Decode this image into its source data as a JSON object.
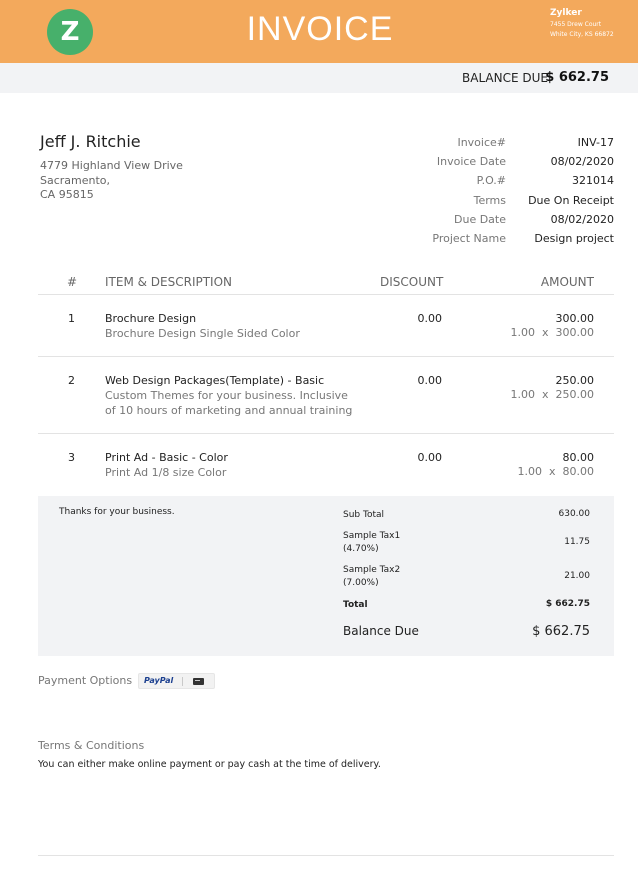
{
  "header": {
    "logo_letter": "Z",
    "title": "INVOICE",
    "company_name": "Zylker",
    "company_address": [
      "7455 Drew Court",
      "White City, KS 66872"
    ],
    "accent_color": "#f3a95c",
    "logo_color": "#47b06b"
  },
  "balance_bar": {
    "label": "BALANCE DUE",
    "value": "$ 662.75"
  },
  "customer": {
    "name": "Jeff J. Ritchie",
    "address": [
      "4779 Highland View Drive",
      "Sacramento,",
      "CA 95815"
    ]
  },
  "meta": [
    {
      "label": "Invoice#",
      "value": "INV-17"
    },
    {
      "label": "Invoice Date",
      "value": "08/02/2020"
    },
    {
      "label": "P.O.#",
      "value": "321014"
    },
    {
      "label": "Terms",
      "value": "Due On Receipt"
    },
    {
      "label": "Due Date",
      "value": "08/02/2020"
    },
    {
      "label": "Project Name",
      "value": "Design project"
    }
  ],
  "table": {
    "headers": {
      "num": "#",
      "item": "ITEM & DESCRIPTION",
      "discount": "DISCOUNT",
      "amount": "AMOUNT"
    },
    "rows": [
      {
        "num": "1",
        "title": "Brochure Design",
        "description": "Brochure Design Single Sided Color",
        "discount": "0.00",
        "amount": "300.00",
        "qty_line": "1.00  x  300.00"
      },
      {
        "num": "2",
        "title": "Web Design Packages(Template) - Basic",
        "description": "Custom Themes for your business. Inclusive of 10 hours of marketing and annual training",
        "discount": "0.00",
        "amount": "250.00",
        "qty_line": "1.00  x  250.00"
      },
      {
        "num": "3",
        "title": "Print Ad - Basic - Color",
        "description": "Print Ad 1/8 size Color",
        "discount": "0.00",
        "amount": "80.00",
        "qty_line": "1.00  x  80.00"
      }
    ]
  },
  "totals": {
    "note": "Thanks for your business.",
    "sub_total": {
      "label": "Sub Total",
      "value": "630.00"
    },
    "tax1": {
      "label": "Sample Tax1",
      "rate": "(4.70%)",
      "value": "11.75"
    },
    "tax2": {
      "label": "Sample Tax2",
      "rate": "(7.00%)",
      "value": "21.00"
    },
    "total": {
      "label": "Total",
      "value": "$ 662.75"
    },
    "balance_due": {
      "label": "Balance Due",
      "value": "$ 662.75"
    }
  },
  "payment": {
    "label": "Payment Options",
    "paypal": "PayPal"
  },
  "terms": {
    "title": "Terms & Conditions",
    "text": "You can either make online payment or pay cash at the time of delivery."
  }
}
